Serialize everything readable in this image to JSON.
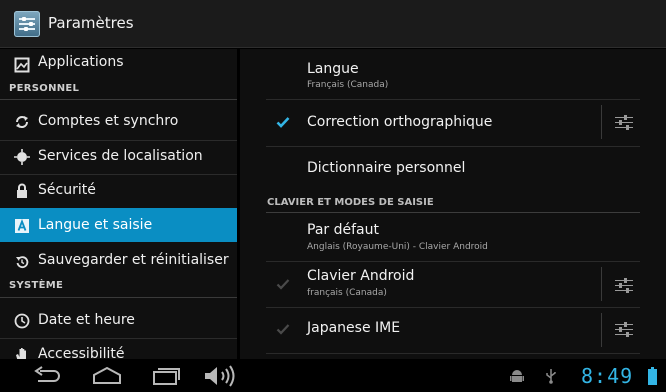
{
  "action_bar": {
    "title": "Paramètres",
    "icon": "settings-icon"
  },
  "sidebar": {
    "items": [
      {
        "label": "Applications",
        "icon": "apps-icon"
      },
      {
        "header": "PERSONNEL"
      },
      {
        "label": "Comptes et synchro",
        "icon": "sync-icon"
      },
      {
        "label": "Services de localisation",
        "icon": "location-icon"
      },
      {
        "label": "Sécurité",
        "icon": "lock-icon"
      },
      {
        "label": "Langue et saisie",
        "icon": "language-icon",
        "selected": true
      },
      {
        "label": "Sauvegarder et réinitialiser",
        "icon": "backup-icon"
      },
      {
        "header": "SYSTÈME"
      },
      {
        "label": "Date et heure",
        "icon": "clock-icon"
      },
      {
        "label": "Accessibilité",
        "icon": "hand-icon"
      }
    ]
  },
  "main": {
    "language": {
      "title": "Langue",
      "value": "Français (Canada)"
    },
    "spellcheck": {
      "title": "Correction orthographique",
      "checked": true
    },
    "dictionary": {
      "title": "Dictionnaire personnel"
    },
    "keyboard_header": "CLAVIER ET MODES DE SAISIE",
    "default_ime": {
      "title": "Par défaut",
      "value": "Anglais (Royaume-Uni) - Clavier Android"
    },
    "android_keyboard": {
      "title": "Clavier Android",
      "value": "français (Canada)",
      "checked": true,
      "disabled": true
    },
    "japanese_ime": {
      "title": "Japanese IME",
      "checked": true,
      "disabled": true
    }
  },
  "status_bar": {
    "time": "8:49",
    "accent_color": "#33b5e5",
    "icons": [
      "android-debug-icon",
      "usb-icon",
      "battery-icon"
    ]
  },
  "nav_bar": {
    "buttons": [
      "back-icon",
      "home-icon",
      "recent-apps-icon",
      "volume-icon"
    ]
  }
}
